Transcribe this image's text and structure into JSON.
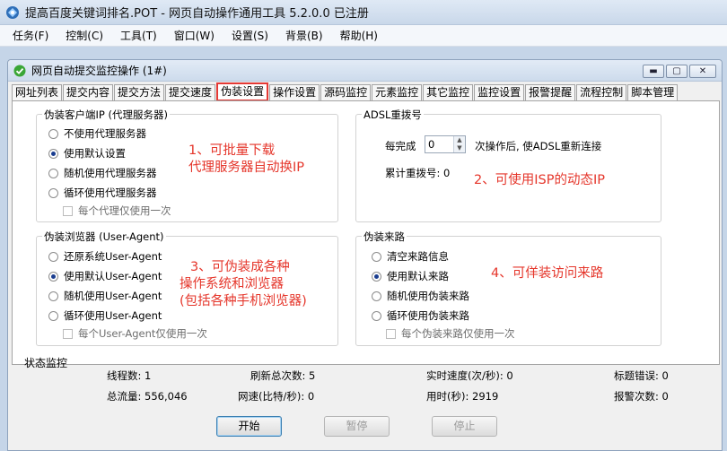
{
  "app": {
    "title": "提高百度关键词排名.POT - 网页自动操作通用工具 5.2.0.0 已注册"
  },
  "menu": [
    "任务(F)",
    "控制(C)",
    "工具(T)",
    "窗口(W)",
    "设置(S)",
    "背景(B)",
    "帮助(H)"
  ],
  "child_window": {
    "title": "网页自动提交监控操作 (1#)",
    "buttons": [
      "minimize-icon",
      "maximize-icon",
      "close-icon"
    ]
  },
  "tabs": [
    "网址列表",
    "提交内容",
    "提交方法",
    "提交速度",
    "伪装设置",
    "操作设置",
    "源码监控",
    "元素监控",
    "其它监控",
    "监控设置",
    "报警提醒",
    "流程控制",
    "脚本管理"
  ],
  "active_tab": "伪装设置",
  "proxy_group": {
    "label": "伪装客户端IP (代理服务器)",
    "options": [
      "不使用代理服务器",
      "使用默认设置",
      "随机使用代理服务器",
      "循环使用代理服务器"
    ],
    "selected": "使用默认设置",
    "once_label": "每个代理仅使用一次"
  },
  "adsl_group": {
    "label": "ADSL重拨号",
    "every_label": "每完成",
    "every_value": "0",
    "after_label": "次操作后, 使ADSL重新连接",
    "count_label": "累计重拨号: 0"
  },
  "browser_group": {
    "label": "伪装浏览器 (User-Agent)",
    "options": [
      "还原系统User-Agent",
      "使用默认User-Agent",
      "随机使用User-Agent",
      "循环使用User-Agent"
    ],
    "selected": "使用默认User-Agent",
    "once_label": "每个User-Agent仅使用一次"
  },
  "referer_group": {
    "label": "伪装来路",
    "options": [
      "清空来路信息",
      "使用默认来路",
      "随机使用伪装来路",
      "循环使用伪装来路"
    ],
    "selected": "使用默认来路",
    "once_label": "每个伪装来路仅使用一次"
  },
  "annotations": {
    "note1_line1": "1、可批量下载",
    "note1_line2": "代理服务器自动换IP",
    "note2": "2、可使用ISP的动态IP",
    "note3_line1": "3、可伪装成各种",
    "note3_line2": "操作系统和浏览器",
    "note3_line3": "(包括各种手机浏览器)",
    "note4": "4、可佯装访问来路"
  },
  "status": {
    "title": "状态监控",
    "threads": "线程数: 1",
    "refresh_total": "刷新总次数: 5",
    "realtime_speed": "实时速度(次/秒): 0",
    "title_errors": "标题错误: 0",
    "total_traffic": "总流量: 556,046",
    "net_speed": "网速(比特/秒): 0",
    "time_used": "用时(秒): 2919",
    "alarm_count": "报警次数: 0"
  },
  "controls": {
    "start": "开始",
    "pause": "暂停",
    "stop": "停止"
  },
  "colors": {
    "annotation": "#e5362b",
    "active_tab_border": "#e53935"
  }
}
